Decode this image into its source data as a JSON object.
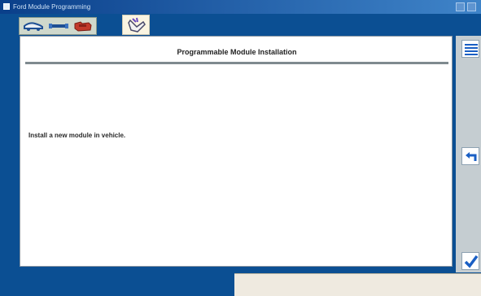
{
  "window": {
    "title": "Ford Module Programming",
    "titlebar_color": "#0a3f8a"
  },
  "toolbar": {
    "icons": [
      "vehicle-icon",
      "cable-icon",
      "engine-icon",
      "hand-pointer-icon"
    ]
  },
  "main": {
    "heading": "Programmable Module Installation",
    "instruction": "Install a new module in vehicle."
  },
  "side_panel": {
    "buttons": [
      "list-icon",
      "back-arrow-icon",
      "checkmark-icon"
    ],
    "accent_color": "#1a5fc4"
  }
}
